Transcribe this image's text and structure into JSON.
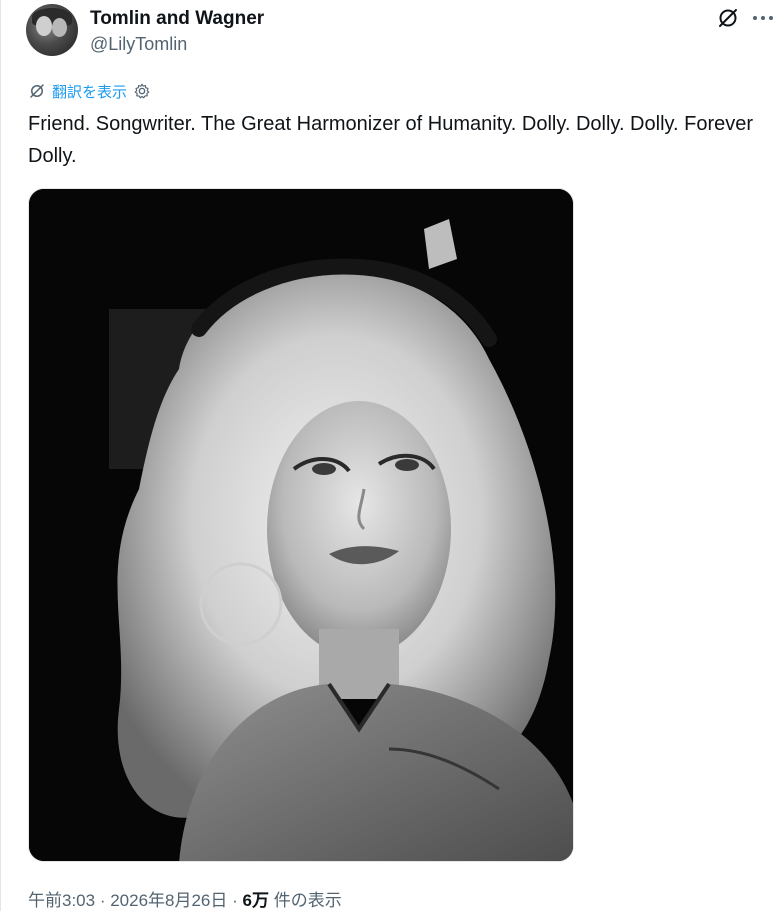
{
  "tweet": {
    "display_name": "Tomlin and Wagner",
    "handle": "@LilyTomlin",
    "translate_label": "翻訳を表示",
    "text": "Friend. Songwriter. The Great Harmonizer of Humanity. Dolly. Dolly. Dolly. Forever Dolly.",
    "time": "午前3:03",
    "separator": " · ",
    "date": "2026年8月26日",
    "views_count": "6万",
    "views_label": " 件の表示"
  },
  "icons": {
    "grok": "grok-icon",
    "more": "more-icon",
    "translate": "translate-icon",
    "settings": "gear-icon"
  },
  "colors": {
    "link": "#1d9bf0",
    "secondary": "#536471",
    "text": "#0f1419"
  }
}
